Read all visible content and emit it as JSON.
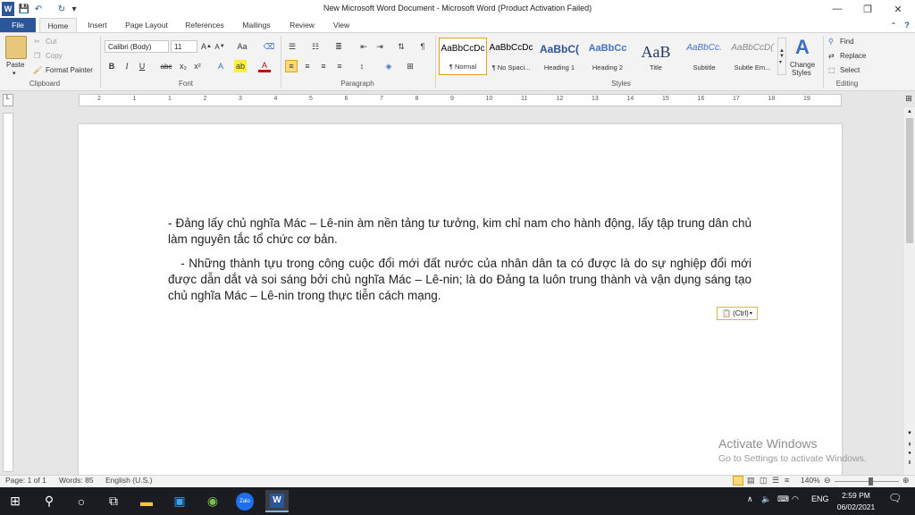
{
  "window": {
    "title": "New Microsoft Word Document  -  Microsoft Word (Product Activation Failed)",
    "minimize": "—",
    "restore": "❐",
    "close": "✕"
  },
  "qat": {
    "app_icon": "W",
    "save": "💾",
    "undo": "↶",
    "redo": "↻",
    "customize": "▾"
  },
  "tabs": [
    "File",
    "Home",
    "Insert",
    "Page Layout",
    "References",
    "Mailings",
    "Review",
    "View"
  ],
  "ribbon": {
    "clipboard": {
      "label": "Clipboard",
      "paste": "Paste",
      "cut": "Cut",
      "copy": "Copy",
      "format_painter": "Format Painter"
    },
    "font": {
      "label": "Font",
      "name": "Calibri (Body)",
      "size": "11"
    },
    "paragraph": {
      "label": "Paragraph"
    },
    "styles": {
      "label": "Styles",
      "items": [
        {
          "sample": "AaBbCcDc",
          "name": "¶ Normal"
        },
        {
          "sample": "AaBbCcDc",
          "name": "¶ No Spaci..."
        },
        {
          "sample": "AaBbC(",
          "name": "Heading 1"
        },
        {
          "sample": "AaBbCc",
          "name": "Heading 2"
        },
        {
          "sample": "AaB",
          "name": "Title"
        },
        {
          "sample": "AaBbCc.",
          "name": "Subtitle"
        },
        {
          "sample": "AaBbCcD(",
          "name": "Subtle Em..."
        }
      ],
      "change_styles_1": "Change",
      "change_styles_2": "Styles"
    },
    "editing": {
      "label": "Editing",
      "find": "Find",
      "replace": "Replace",
      "select": "Select"
    }
  },
  "ruler_numbers": [
    "2",
    "1",
    "1",
    "2",
    "3",
    "4",
    "5",
    "6",
    "7",
    "8",
    "9",
    "10",
    "11",
    "12",
    "13",
    "14",
    "15",
    "16",
    "17",
    "18",
    "19"
  ],
  "document": {
    "para1": "- Đảng lấy chủ nghĩa Mác – Lê-nin àm nền tảng tư tưởng, kim chỉ nam cho hành động, lấy tập trung dân chủ làm nguyên tắc tổ chức cơ bản.",
    "para2": "   - Những thành tựu trong công cuộc đổi mới đất nước của nhân dân ta có được là do sự nghiệp đổi mới được dẫn dắt và soi sáng bởi chủ nghĩa Mác – Lê-nin; là do Đảng ta luôn trung thành và vận dụng sáng tạo chủ nghĩa Mác – Lê-nin trong thực tiễn cách mạng.",
    "paste_options": "(Ctrl)"
  },
  "watermark": {
    "line1": "Activate Windows",
    "line2": "Go to Settings to activate Windows."
  },
  "status": {
    "page": "Page: 1 of 1",
    "words": "Words: 85",
    "language": "English (U.S.)",
    "zoom": "140%"
  },
  "taskbar": {
    "time": "2:59 PM",
    "date": "06/02/2021",
    "lang": "ENG",
    "zalo": "Zalo"
  }
}
